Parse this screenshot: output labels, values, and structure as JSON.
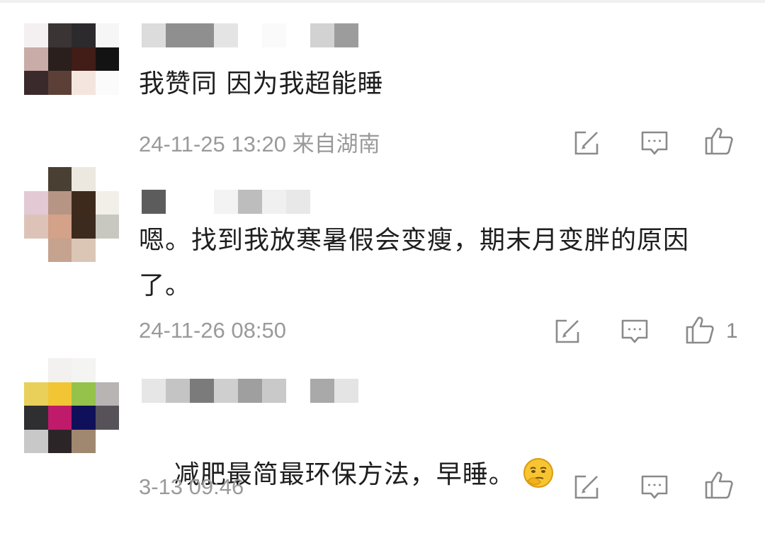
{
  "comments": [
    {
      "text": "我赞同 因为我超能睡",
      "meta": "24-11-25 13:20 来自湖南",
      "like_count": "",
      "avatar": [
        "#f4f0f1",
        "#3a3435",
        "#2c2a2c",
        "#f6f6f7",
        "#c9aba7",
        "#2a1f1c",
        "#421c17",
        "#131314",
        "#3a2a2c",
        "#5c4038",
        "#f4e6de",
        "#fbfbfb",
        "#ffffff",
        "#ffffff",
        "#ffffff",
        "#ffffff"
      ]
    },
    {
      "text": "嗯。找到我放寒暑假会变瘦，期末月变胖的原因了。",
      "meta": "24-11-26 08:50",
      "like_count": "1",
      "avatar": [
        "#ffffff",
        "#4a3f33",
        "#ece7df",
        "#ffffff",
        "#e3c9d4",
        "#b79584",
        "#3e2a1d",
        "#f2efe9",
        "#ddc3b7",
        "#d3a289",
        "#3c2a1e",
        "#c9c8c0",
        "#ffffff",
        "#c5a38e",
        "#dbc6b6",
        "#ffffff"
      ]
    },
    {
      "text": "减肥最简最环保方法，早睡。",
      "meta": "3-13 09:46",
      "like_count": "",
      "avatar": [
        "#ffffff",
        "#f2f1ef",
        "#f4f4f2",
        "#ffffff",
        "#e8d05a",
        "#f2c534",
        "#95c24b",
        "#b8b4b4",
        "#2f2f32",
        "#c01a6a",
        "#10105a",
        "#57525a",
        "#c8c8c8",
        "#2c2528",
        "#a08870",
        "#ffffff"
      ]
    }
  ],
  "icons": {
    "reply": "edit-icon",
    "comment": "comment-icon",
    "like": "thumbs-up-icon",
    "emoji": "thinking-face-emoji-icon"
  }
}
